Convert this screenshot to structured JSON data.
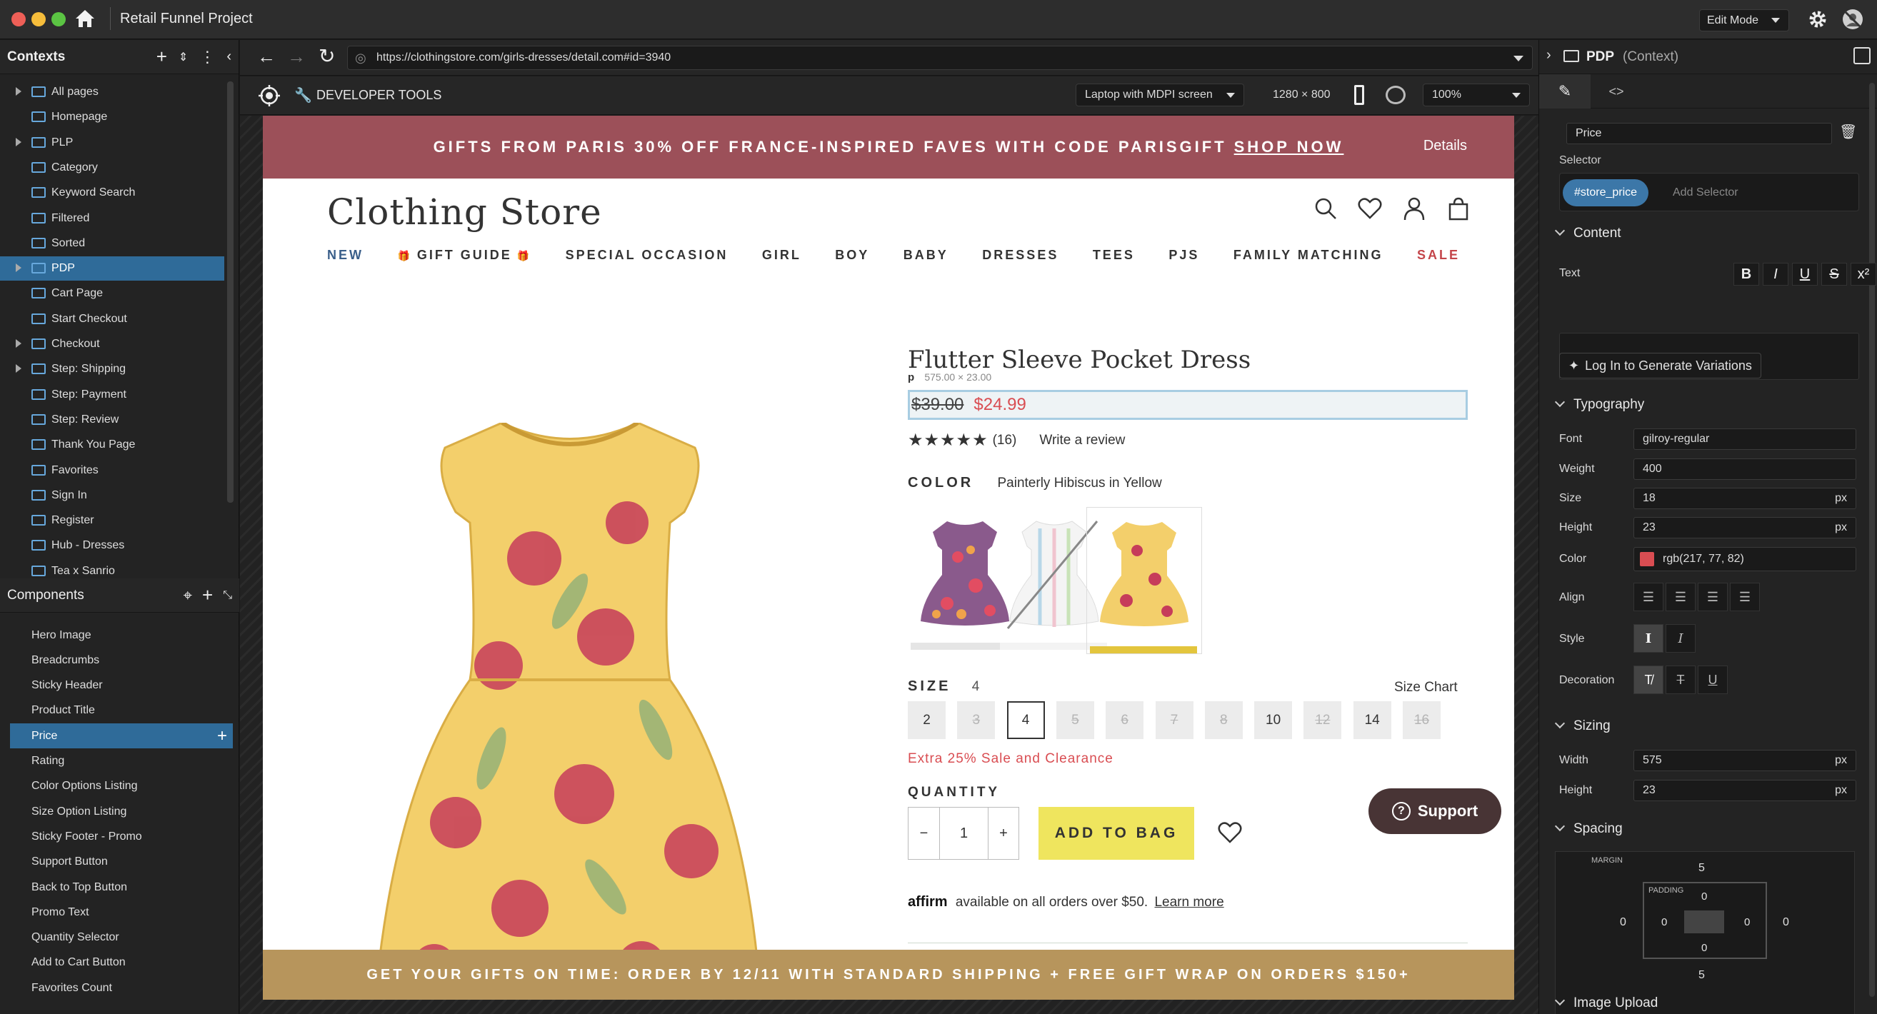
{
  "app": {
    "title": "Retail Funnel Project",
    "mode": "Edit Mode"
  },
  "contexts": {
    "heading": "Contexts",
    "items": [
      {
        "label": "All pages",
        "expandable": true
      },
      {
        "label": "Homepage",
        "expandable": false
      },
      {
        "label": "PLP",
        "expandable": true
      },
      {
        "label": "Category",
        "expandable": false
      },
      {
        "label": "Keyword Search",
        "expandable": false
      },
      {
        "label": "Filtered",
        "expandable": false
      },
      {
        "label": "Sorted",
        "expandable": false
      },
      {
        "label": "PDP",
        "expandable": true,
        "selected": true
      },
      {
        "label": "Cart Page",
        "expandable": false
      },
      {
        "label": "Start Checkout",
        "expandable": false
      },
      {
        "label": "Checkout",
        "expandable": true
      },
      {
        "label": "Step: Shipping",
        "expandable": true
      },
      {
        "label": "Step: Payment",
        "expandable": false
      },
      {
        "label": "Step: Review",
        "expandable": false
      },
      {
        "label": "Thank You Page",
        "expandable": false
      },
      {
        "label": "Favorites",
        "expandable": false
      },
      {
        "label": "Sign In",
        "expandable": false
      },
      {
        "label": "Register",
        "expandable": false
      },
      {
        "label": "Hub - Dresses",
        "expandable": false
      },
      {
        "label": "Tea x Sanrio",
        "expandable": false
      }
    ]
  },
  "components": {
    "heading": "Components",
    "items": [
      "Hero Image",
      "Breadcrumbs",
      "Sticky Header",
      "Product Title",
      "Price",
      "Rating",
      "Color Options Listing",
      "Size Option Listing",
      "Sticky Footer - Promo",
      "Support Button",
      "Back to Top Button",
      "Promo Text",
      "Quantity Selector",
      "Add to Cart Button",
      "Favorites Count"
    ],
    "selected_index": 4
  },
  "browser": {
    "url": "https://clothingstore.com/girls-dresses/detail.com#id=3940",
    "devtools_label": "DEVELOPER TOOLS",
    "device": "Laptop with MDPI screen",
    "resolution": "1280 × 800",
    "zoom": "100%"
  },
  "site": {
    "promo_top": "GIFTS FROM PARIS 30% OFF FRANCE-INSPIRED FAVES WITH CODE PARISGIFT",
    "promo_shop": "SHOP NOW",
    "promo_details": "Details",
    "logo": "Clothing Store",
    "nav": [
      "NEW",
      "GIFT GUIDE",
      "SPECIAL OCCASION",
      "GIRL",
      "BOY",
      "BABY",
      "DRESSES",
      "TEES",
      "PJS",
      "FAMILY MATCHING",
      "SALE"
    ],
    "product_title": "Flutter Sleeve Pocket Dress",
    "p_tag": "p",
    "p_dims": "575.00 × 23.00",
    "price_old": "$39.00",
    "price_new": "$24.99",
    "review_count": "(16)",
    "write_review": "Write a review",
    "color_label": "COLOR",
    "color_value": "Painterly Hibiscus in Yellow",
    "size_label": "SIZE",
    "size_value": "4",
    "size_chart": "Size Chart",
    "sizes": [
      {
        "label": "2",
        "state": "available"
      },
      {
        "label": "3",
        "state": "na"
      },
      {
        "label": "4",
        "state": "selected"
      },
      {
        "label": "5",
        "state": "na"
      },
      {
        "label": "6",
        "state": "na"
      },
      {
        "label": "7",
        "state": "na"
      },
      {
        "label": "8",
        "state": "na"
      },
      {
        "label": "10",
        "state": "available"
      },
      {
        "label": "12",
        "state": "na"
      },
      {
        "label": "14",
        "state": "available"
      },
      {
        "label": "16",
        "state": "na"
      }
    ],
    "sale_text": "Extra 25% Sale and Clearance",
    "quantity_label": "QUANTITY",
    "quantity": "1",
    "qty_minus": "−",
    "qty_plus": "+",
    "add_to_bag": "ADD TO BAG",
    "support": "Support",
    "affirm_logo": "affirm",
    "affirm_text": "available on all orders over $50.",
    "affirm_link": "Learn more",
    "promo_bottom": "GET YOUR GIFTS ON TIME: ORDER BY 12/11 WITH STANDARD SHIPPING + FREE GIFT WRAP ON ORDERS $150+"
  },
  "inspector": {
    "context_name": "PDP",
    "context_suffix": "(Context)",
    "component_name": "Price",
    "selector_label": "Selector",
    "selector_tag": "#store_price",
    "add_selector": "Add Selector",
    "content_heading": "Content",
    "text_label": "Text",
    "format_buttons": [
      "B",
      "I",
      "U",
      "S",
      "x²"
    ],
    "generate_button": "Log In to Generate Variations",
    "typography_heading": "Typography",
    "font_label": "Font",
    "font_value": "gilroy-regular",
    "weight_label": "Weight",
    "weight_value": "400",
    "size_label": "Size",
    "size_value": "18",
    "size_unit": "px",
    "height_label": "Height",
    "height_value": "23",
    "height_unit": "px",
    "color_label": "Color",
    "color_value": "rgb(217, 77, 82)",
    "color_swatch": "#d94d52",
    "align_label": "Align",
    "style_label": "Style",
    "decoration_label": "Decoration",
    "sizing_heading": "Sizing",
    "sizing_width_label": "Width",
    "sizing_width_value": "575",
    "sizing_width_unit": "px",
    "sizing_height_label": "Height",
    "sizing_height_value": "23",
    "sizing_height_unit": "px",
    "spacing_heading": "Spacing",
    "margin_label": "MARGIN",
    "padding_label": "PADDING",
    "margin": {
      "top": "5",
      "right": "0",
      "bottom": "5",
      "left": "0"
    },
    "padding": {
      "top": "0",
      "right": "0",
      "bottom": "0",
      "left": "0"
    },
    "image_upload_heading": "Image Upload"
  },
  "colors": {
    "accent": "#2f6b99",
    "promo_top": "#9c5059",
    "promo_bottom": "#b7955c",
    "add_to_bag": "#efe55e",
    "sale": "#d94d52",
    "support": "#483435"
  }
}
